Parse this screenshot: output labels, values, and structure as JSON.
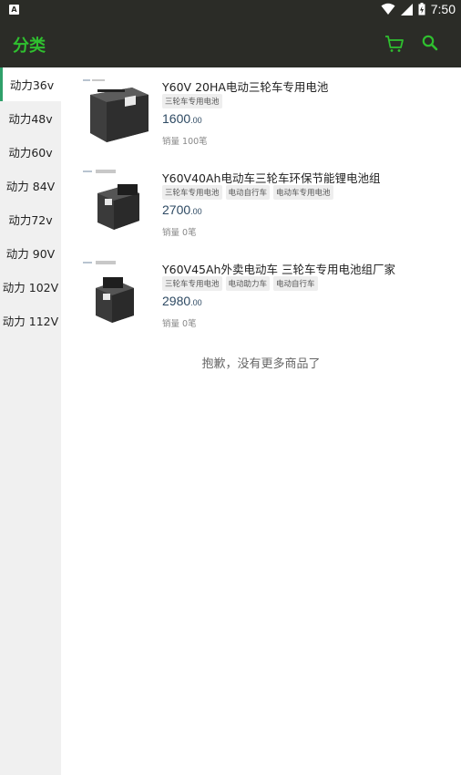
{
  "status_bar": {
    "time": "7:50",
    "app_badge": "A"
  },
  "header": {
    "title": "分类",
    "accent_color": "#2fc02f"
  },
  "sidebar": {
    "items": [
      {
        "label": "动力36v",
        "active": true
      },
      {
        "label": "动力48v",
        "active": false
      },
      {
        "label": "动力60v",
        "active": false
      },
      {
        "label": "动力 84V",
        "active": false
      },
      {
        "label": "动力72v",
        "active": false
      },
      {
        "label": "动力 90V",
        "active": false
      },
      {
        "label": "动力 102V",
        "active": false
      },
      {
        "label": "动力 112V",
        "active": false
      }
    ]
  },
  "products": [
    {
      "title": "Y60V 20HA电动三轮车专用电池",
      "tags": [
        "三轮车专用电池"
      ],
      "price_int": "1600",
      "price_dec": ".00",
      "sales": "销量 100笔"
    },
    {
      "title": "Y60V40Ah电动车三轮车环保节能锂电池组",
      "tags": [
        "三轮车专用电池",
        "电动自行车",
        "电动车专用电池"
      ],
      "price_int": "2700",
      "price_dec": ".00",
      "sales": "销量 0笔"
    },
    {
      "title": "Y60V45Ah外卖电动车 三轮车专用电池组厂家",
      "tags": [
        "三轮车专用电池",
        "电动助力车",
        "电动自行车"
      ],
      "price_int": "2980",
      "price_dec": ".00",
      "sales": "销量 0笔"
    }
  ],
  "end_message": "抱歉，没有更多商品了",
  "icons": {
    "cart": "cart-icon",
    "search": "search-icon"
  }
}
